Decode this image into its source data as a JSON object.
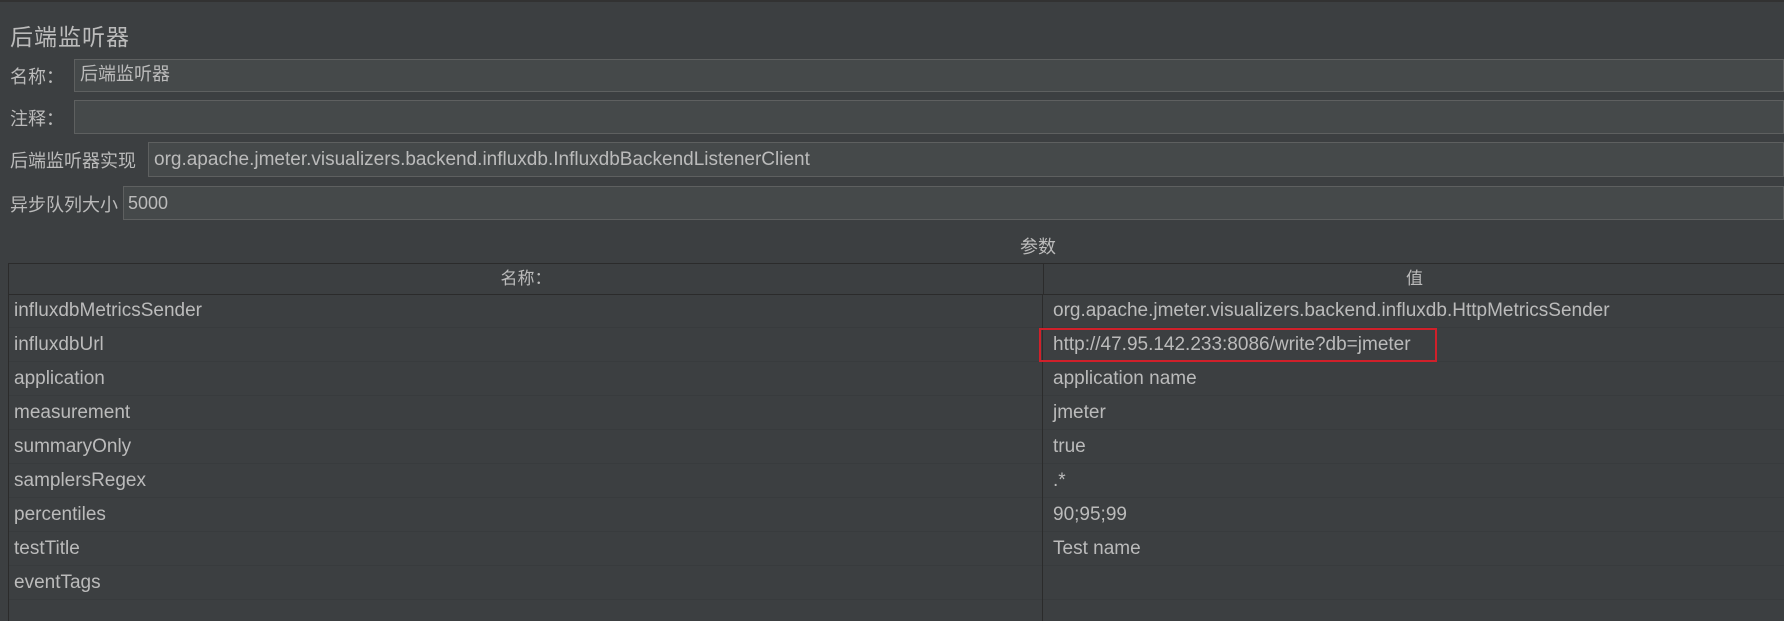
{
  "panel": {
    "title": "后端监听器",
    "name_label": "名称：",
    "name_value": "后端监听器",
    "comment_label": "注释：",
    "comment_value": "",
    "impl_label": "后端监听器实现",
    "impl_value": "org.apache.jmeter.visualizers.backend.influxdb.InfluxdbBackendListenerClient",
    "queue_label": "异步队列大小",
    "queue_value": "5000"
  },
  "params": {
    "section_label": "参数",
    "headers": [
      "名称：",
      "值"
    ],
    "rows": [
      {
        "name": "influxdbMetricsSender",
        "value": "org.apache.jmeter.visualizers.backend.influxdb.HttpMetricsSender"
      },
      {
        "name": "influxdbUrl",
        "value": "http://47.95.142.233:8086/write?db=jmeter"
      },
      {
        "name": "application",
        "value": "application name"
      },
      {
        "name": "measurement",
        "value": "jmeter"
      },
      {
        "name": "summaryOnly",
        "value": "true"
      },
      {
        "name": "samplersRegex",
        "value": ".*"
      },
      {
        "name": "percentiles",
        "value": "90;95;99"
      },
      {
        "name": "testTitle",
        "value": "Test name"
      },
      {
        "name": "eventTags",
        "value": ""
      }
    ]
  },
  "highlight": {
    "color": "#d0202a",
    "target": "influxdbUrl"
  }
}
